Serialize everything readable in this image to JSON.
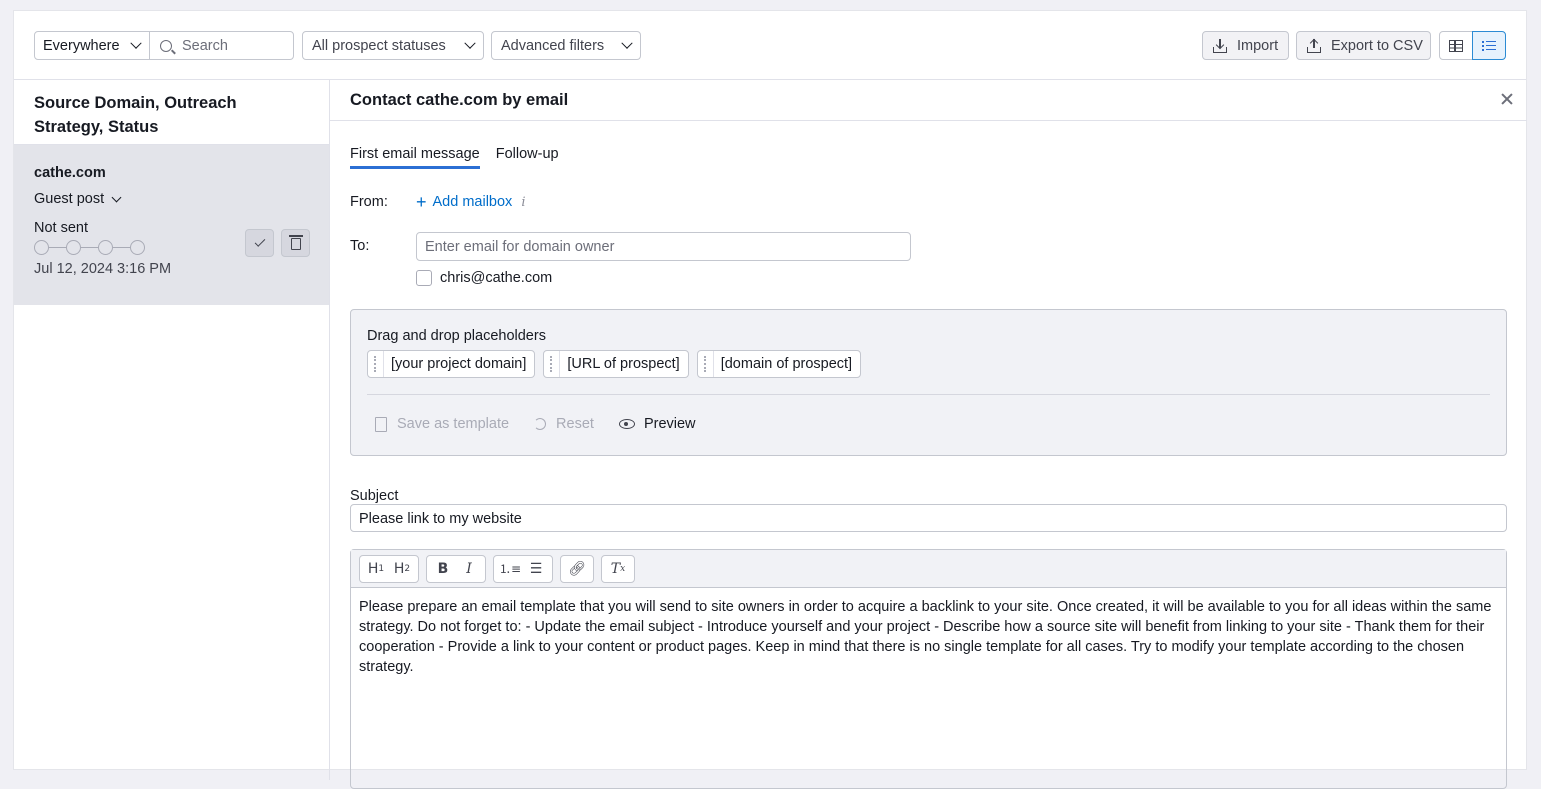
{
  "toolbar": {
    "location_select": "Everywhere",
    "search_placeholder": "Search",
    "status_select": "All prospect statuses",
    "advanced_filters": "Advanced filters",
    "import_label": "Import",
    "export_label": "Export to CSV",
    "view_icons": [
      "table-view-icon",
      "list-view-icon"
    ],
    "active_view": "list"
  },
  "sidebar": {
    "heading": "Source Domain, Outreach Strategy, Status",
    "items": [
      {
        "domain": "cathe.com",
        "strategy": "Guest post",
        "status": "Not sent",
        "date": "Jul 12, 2024 3:16 PM",
        "steps_total": 4,
        "steps_done": 0
      }
    ]
  },
  "panel": {
    "title": "Contact cathe.com by email",
    "tabs": [
      "First email message",
      "Follow-up"
    ],
    "active_tab": 0,
    "from_label": "From:",
    "add_mailbox": "Add mailbox",
    "to_label": "To:",
    "to_placeholder": "Enter email for domain owner",
    "suggested_email": "chris@cathe.com",
    "placeholders_title": "Drag and drop placeholders",
    "placeholders": [
      "[your project domain]",
      "[URL of prospect]",
      "[domain of prospect]"
    ],
    "actions": {
      "save_template": "Save as template",
      "reset": "Reset",
      "preview": "Preview"
    },
    "subject_label": "Subject",
    "subject_value": "Please link to my website",
    "editor_body": "Please prepare an email template that you will send to site owners in order to acquire a backlink to your site. Once created, it will be available to you for all ideas within the same strategy. Do not forget to: - Update the email subject - Introduce yourself and your project - Describe how a source site will benefit from linking to your site - Thank them for their cooperation - Provide a link to your content or product pages. Keep in mind that there is no single template for all cases. Try to modify your template according to the chosen strategy."
  },
  "colors": {
    "accent": "#2b6fd4",
    "link": "#006dca",
    "selected_row": "#e3e4ea"
  }
}
